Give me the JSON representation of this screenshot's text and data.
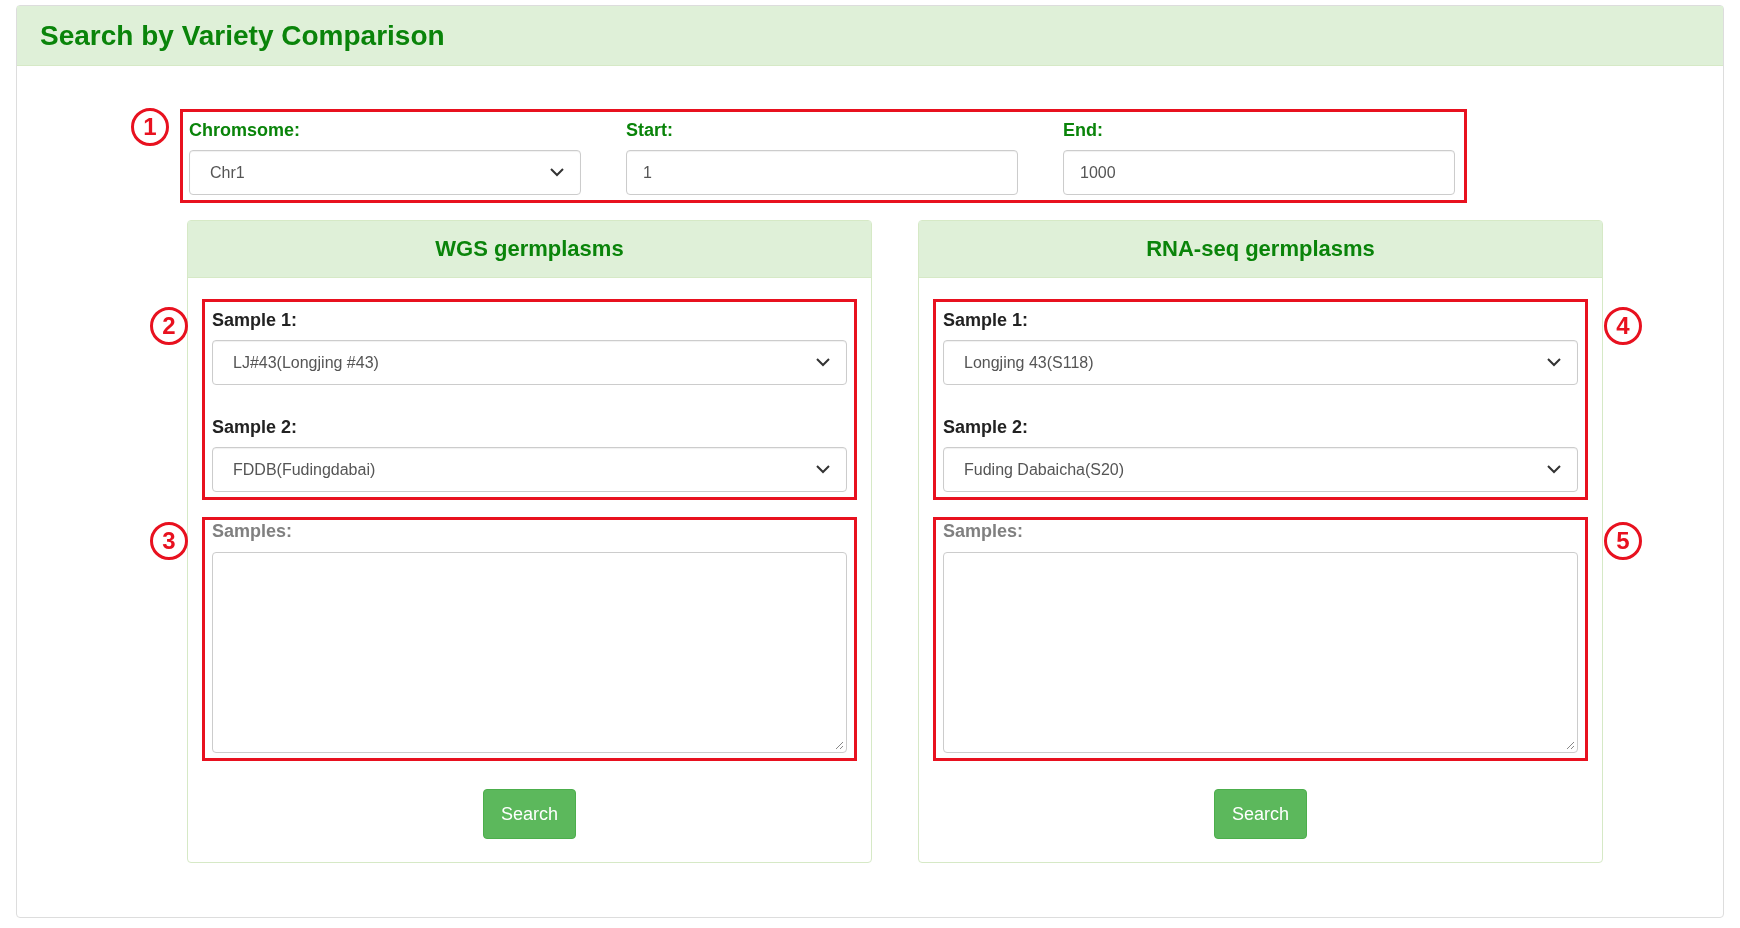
{
  "title": "Search by Variety Comparison",
  "region": {
    "annotation": "1",
    "fields": [
      {
        "kind": "select",
        "label": "Chromsome:",
        "value": "Chr1"
      },
      {
        "kind": "text",
        "label": "Start:",
        "value": "1"
      },
      {
        "kind": "text",
        "label": "End:",
        "value": "1000"
      }
    ]
  },
  "panels": [
    {
      "title": "WGS germplasms",
      "samples_annotation": "2",
      "samples": [
        {
          "label": "Sample 1:",
          "value": "LJ#43(Longjing #43)"
        },
        {
          "label": "Sample 2:",
          "value": "FDDB(Fudingdabai)"
        }
      ],
      "list_annotation": "3",
      "list_label": "Samples:",
      "button": "Search"
    },
    {
      "title": "RNA-seq germplasms",
      "samples_annotation": "4",
      "samples": [
        {
          "label": "Sample 1:",
          "value": "Longjing 43(S118)"
        },
        {
          "label": "Sample 2:",
          "value": "Fuding Dabaicha(S20)"
        }
      ],
      "list_annotation": "5",
      "list_label": "Samples:",
      "button": "Search"
    }
  ]
}
